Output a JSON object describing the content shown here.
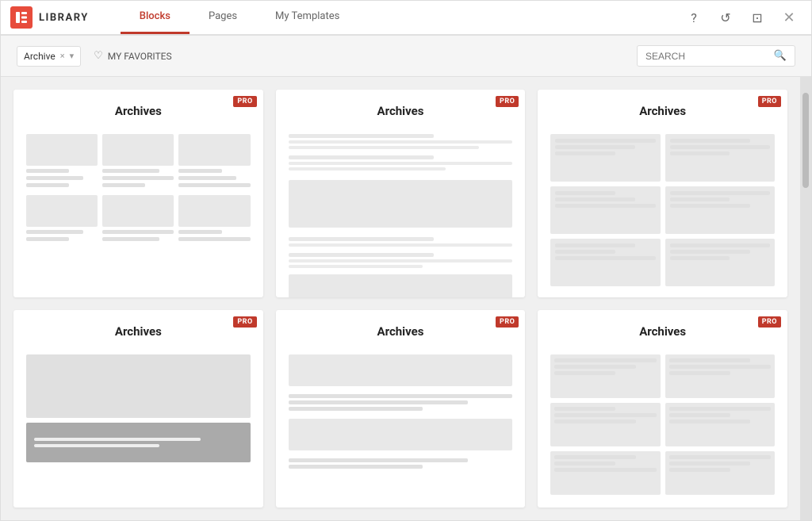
{
  "header": {
    "logo_text": "LIBRARY",
    "tabs": [
      {
        "id": "blocks",
        "label": "Blocks",
        "active": true
      },
      {
        "id": "pages",
        "label": "Pages",
        "active": false
      },
      {
        "id": "my-templates",
        "label": "My Templates",
        "active": false
      }
    ],
    "actions": {
      "help": "?",
      "refresh": "↺",
      "save": "⊡",
      "close": "✕"
    }
  },
  "toolbar": {
    "filter_label": "Archive",
    "filter_x": "×",
    "filter_chevron": "▾",
    "favorites_label": "MY FAVORITES",
    "search_placeholder": "SEARCH"
  },
  "cards": [
    {
      "id": "card-1",
      "title": "Archives",
      "pro": true,
      "layout": "grid3"
    },
    {
      "id": "card-2",
      "title": "Archives",
      "pro": true,
      "layout": "list"
    },
    {
      "id": "card-3",
      "title": "Archives",
      "pro": true,
      "layout": "grid2x3"
    },
    {
      "id": "card-4",
      "title": "Archives",
      "pro": true,
      "layout": "bigimg"
    },
    {
      "id": "card-5",
      "title": "Archives",
      "pro": true,
      "layout": "card5"
    },
    {
      "id": "card-6",
      "title": "Archives",
      "pro": true,
      "layout": "card6"
    }
  ],
  "pro_label": "PRO"
}
